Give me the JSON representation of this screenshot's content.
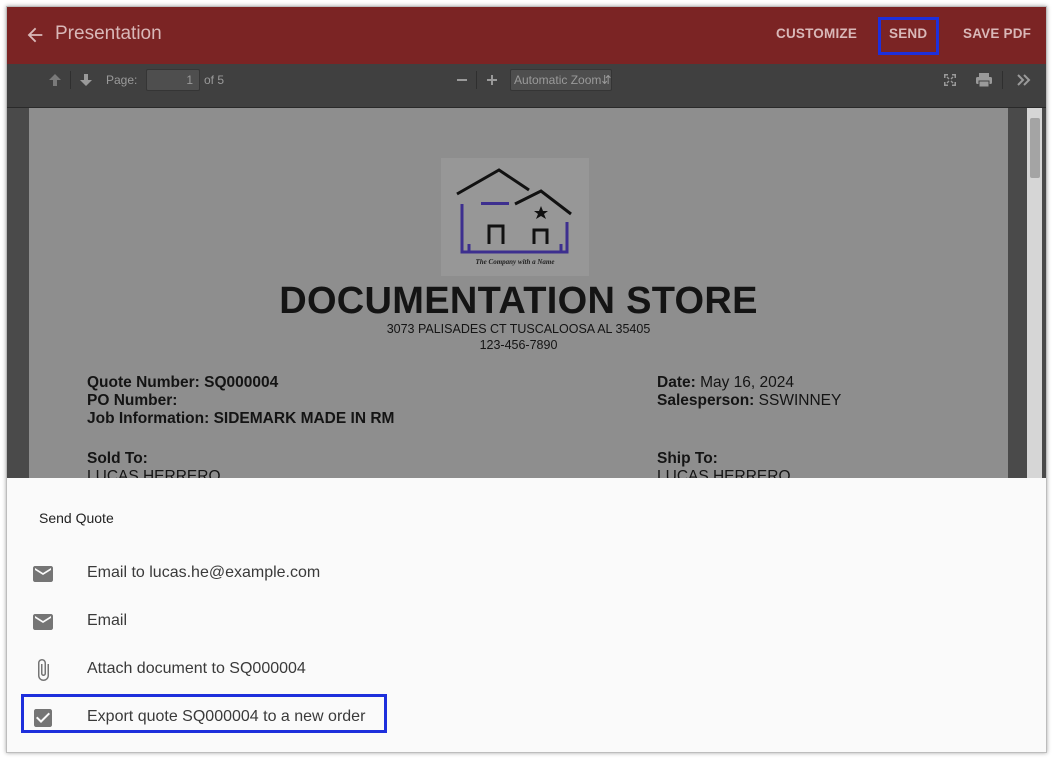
{
  "header": {
    "title": "Presentation",
    "customize_label": "CUSTOMIZE",
    "send_label": "SEND",
    "save_pdf_label": "SAVE PDF"
  },
  "toolbar": {
    "page_label": "Page:",
    "current_page": "1",
    "page_count_label": "of 5",
    "zoom_label": "Automatic Zoom"
  },
  "document": {
    "store_name": "DOCUMENTATION STORE",
    "address": "3073 PALISADES CT TUSCALOOSA AL 35405",
    "phone": "123-456-7890",
    "logo_tagline": "The Company with a Name",
    "quote_number_label": "Quote Number:",
    "quote_number": "SQ000004",
    "po_number_label": "PO Number:",
    "job_info_label": "Job Information:",
    "job_info": "SIDEMARK MADE IN RM",
    "date_label": "Date:",
    "date": "May 16, 2024",
    "salesperson_label": "Salesperson:",
    "salesperson": "SSWINNEY",
    "sold_to_label": "Sold To:",
    "sold_to_name": "LUCAS HERRERO",
    "ship_to_label": "Ship To:",
    "ship_to_name": "LUCAS HERRERO"
  },
  "sheet": {
    "title": "Send Quote",
    "items": [
      {
        "label": "Email to lucas.he@example.com",
        "icon": "email-icon"
      },
      {
        "label": "Email",
        "icon": "email-icon"
      },
      {
        "label": "Attach document to SQ000004",
        "icon": "paperclip-icon"
      },
      {
        "label": "Export quote SQ000004 to a new order",
        "icon": "checkbox-icon"
      }
    ]
  },
  "colors": {
    "header_bg": "#7b2424",
    "header_text": "#d9b8b8",
    "highlight": "#1e2fdc",
    "logo_purple": "#3d2f8f"
  }
}
